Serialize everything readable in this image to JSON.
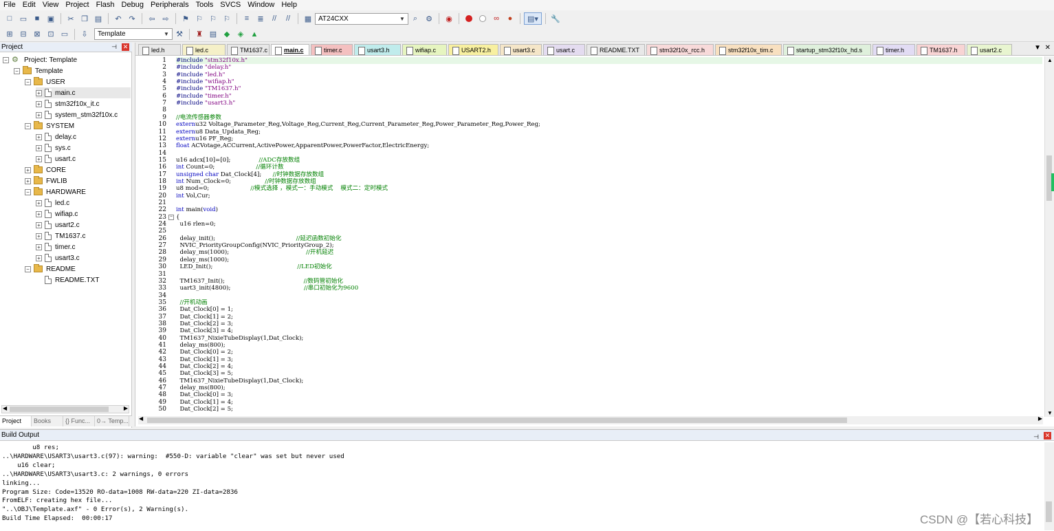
{
  "menu": [
    "File",
    "Edit",
    "View",
    "Project",
    "Flash",
    "Debug",
    "Peripherals",
    "Tools",
    "SVCS",
    "Window",
    "Help"
  ],
  "toolbar": {
    "target_combo": "AT24CXX",
    "target_select": "Template"
  },
  "project_panel": {
    "title": "Project",
    "tree": [
      {
        "label": "Project: Template",
        "kind": "project",
        "level": 0
      },
      {
        "label": "Template",
        "kind": "group",
        "level": 1
      },
      {
        "label": "USER",
        "kind": "folder",
        "level": 2
      },
      {
        "label": "main.c",
        "kind": "file",
        "level": 3,
        "selected": true
      },
      {
        "label": "stm32f10x_it.c",
        "kind": "file",
        "level": 3
      },
      {
        "label": "system_stm32f10x.c",
        "kind": "file",
        "level": 3
      },
      {
        "label": "SYSTEM",
        "kind": "folder",
        "level": 2
      },
      {
        "label": "delay.c",
        "kind": "file",
        "level": 3
      },
      {
        "label": "sys.c",
        "kind": "file",
        "level": 3
      },
      {
        "label": "usart.c",
        "kind": "file",
        "level": 3
      },
      {
        "label": "CORE",
        "kind": "folder-collapsed",
        "level": 2
      },
      {
        "label": "FWLIB",
        "kind": "folder-collapsed",
        "level": 2
      },
      {
        "label": "HARDWARE",
        "kind": "folder",
        "level": 2
      },
      {
        "label": "led.c",
        "kind": "file",
        "level": 3
      },
      {
        "label": "wifiap.c",
        "kind": "file",
        "level": 3
      },
      {
        "label": "usart2.c",
        "kind": "file",
        "level": 3
      },
      {
        "label": "TM1637.c",
        "kind": "file",
        "level": 3
      },
      {
        "label": "timer.c",
        "kind": "file",
        "level": 3
      },
      {
        "label": "usart3.c",
        "kind": "file",
        "level": 3
      },
      {
        "label": "README",
        "kind": "folder",
        "level": 2
      },
      {
        "label": "README.TXT",
        "kind": "file-plain",
        "level": 3
      }
    ],
    "bottom_tabs": [
      "Project",
      "Books",
      "{} Func...",
      "0→ Temp..."
    ]
  },
  "editor_tabs": [
    {
      "label": "led.h",
      "color": "#e8e8e8"
    },
    {
      "label": "led.c",
      "color": "#f5f0c8"
    },
    {
      "label": "TM1637.c",
      "color": "#e8e8e8"
    },
    {
      "label": "main.c",
      "color": "#ffffff",
      "active": true
    },
    {
      "label": "timer.c",
      "color": "#f4c0c0"
    },
    {
      "label": "usart3.h",
      "color": "#c0ecec"
    },
    {
      "label": "wifiap.c",
      "color": "#e6f5c0"
    },
    {
      "label": "USART2.h",
      "color": "#f8f0a0"
    },
    {
      "label": "usart3.c",
      "color": "#f5e6c8"
    },
    {
      "label": "usart.c",
      "color": "#e4dcf0"
    },
    {
      "label": "README.TXT",
      "color": "#e8e8e8"
    },
    {
      "label": "stm32f10x_rcc.h",
      "color": "#f8dada"
    },
    {
      "label": "stm32f10x_tim.c",
      "color": "#f8e0c0"
    },
    {
      "label": "startup_stm32f10x_hd.s",
      "color": "#dff0dc"
    },
    {
      "label": "timer.h",
      "color": "#e2dcf4"
    },
    {
      "label": "TM1637.h",
      "color": "#f8d4d4"
    },
    {
      "label": "usart2.c",
      "color": "#e8f5d0"
    }
  ],
  "code_lines": [
    "1",
    "2",
    "3",
    "4",
    "5",
    "6",
    "7",
    "8",
    "9",
    "10",
    "11",
    "12",
    "13",
    "14",
    "15",
    "16",
    "17",
    "18",
    "19",
    "20",
    "21",
    "22",
    "23",
    "24",
    "25",
    "26",
    "27",
    "28",
    "29",
    "30",
    "31",
    "32",
    "33",
    "34",
    "35",
    "36",
    "37",
    "38",
    "39",
    "40",
    "41",
    "42",
    "43",
    "44",
    "45",
    "46",
    "47",
    "48",
    "49",
    "50"
  ],
  "code": [
    {
      "t": [
        [
          "pp",
          "#include "
        ],
        [
          "str",
          "\"stm32f10x.h\""
        ]
      ]
    },
    {
      "t": [
        [
          "pp",
          "#include "
        ],
        [
          "str",
          "\"delay.h\""
        ]
      ]
    },
    {
      "t": [
        [
          "pp",
          "#include "
        ],
        [
          "str",
          "\"led.h\""
        ]
      ]
    },
    {
      "t": [
        [
          "pp",
          "#include "
        ],
        [
          "str",
          "\"wifiap.h\""
        ]
      ]
    },
    {
      "t": [
        [
          "pp",
          "#include "
        ],
        [
          "str",
          "\"TM1637.h\""
        ]
      ]
    },
    {
      "t": [
        [
          "pp",
          "#include "
        ],
        [
          "str",
          "\"timer.h\""
        ]
      ]
    },
    {
      "t": [
        [
          "pp",
          "#include "
        ],
        [
          "str",
          "\"usart3.h\""
        ]
      ]
    },
    {
      "t": []
    },
    {
      "t": [
        [
          "cm",
          "//电流传感器参数"
        ]
      ]
    },
    {
      "t": [
        [
          "kw",
          "extern"
        ],
        [
          "",
          "u32 Voltage_Parameter_Reg,Voltage_Reg,Current_Reg,Current_Parameter_Reg,Power_Parameter_Reg,Power_Reg;"
        ]
      ]
    },
    {
      "t": [
        [
          "kw",
          "extern"
        ],
        [
          "",
          "u8 Data_Updata_Reg;"
        ]
      ]
    },
    {
      "t": [
        [
          "kw",
          "extern"
        ],
        [
          "",
          "u16 PF_Reg;"
        ]
      ]
    },
    {
      "t": [
        [
          "kw",
          "float"
        ],
        [
          "",
          " ACVotage,ACCurrent,ActivePower,ApparentPower,PowerFactor,ElectricEnergy;"
        ]
      ]
    },
    {
      "t": []
    },
    {
      "t": [
        [
          "",
          "u16 adcx[10]=[0];               "
        ],
        [
          "cm",
          "//ADC存放数组"
        ]
      ]
    },
    {
      "t": [
        [
          "kw",
          "int"
        ],
        [
          "",
          " Count=0;                      "
        ],
        [
          "cm",
          "//循环计数"
        ]
      ]
    },
    {
      "t": [
        [
          "kw",
          "unsigned char"
        ],
        [
          "",
          " Dat_Clock[4];      "
        ],
        [
          "cm",
          "//时钟数据存放数组"
        ]
      ]
    },
    {
      "t": [
        [
          "kw",
          "int"
        ],
        [
          "",
          " Num_Clock=0;                  "
        ],
        [
          "cm",
          "//时钟数据存放数组"
        ]
      ]
    },
    {
      "t": [
        [
          "",
          "u8 mod=0;                      "
        ],
        [
          "cm",
          "//模式选择 ，模式一：手动模式    模式二：定时模式"
        ]
      ]
    },
    {
      "t": [
        [
          "kw",
          "int"
        ],
        [
          "",
          " Vol,Cur;"
        ]
      ]
    },
    {
      "t": []
    },
    {
      "t": [
        [
          "kw",
          "int"
        ],
        [
          "",
          " main("
        ],
        [
          "kw",
          "void"
        ],
        [
          "",
          ")"
        ]
      ]
    },
    {
      "t": [
        [
          "",
          "{"
        ]
      ]
    },
    {
      "t": [
        [
          "",
          "  u16 rlen=0;"
        ]
      ]
    },
    {
      "t": []
    },
    {
      "t": [
        [
          "",
          "  delay_init();                                           "
        ],
        [
          "cm",
          "//延迟函数初始化"
        ]
      ]
    },
    {
      "t": [
        [
          "",
          "  NVIC_PriorityGroupConfig(NVIC_PriorityGroup_2);"
        ]
      ]
    },
    {
      "t": [
        [
          "",
          "  delay_ms(1000);                                         "
        ],
        [
          "cm",
          "//开机延迟"
        ]
      ]
    },
    {
      "t": [
        [
          "",
          "  delay_ms(1000);"
        ]
      ]
    },
    {
      "t": [
        [
          "",
          "  LED_Init();                                             "
        ],
        [
          "cm",
          "//LED初始化"
        ]
      ]
    },
    {
      "t": []
    },
    {
      "t": [
        [
          "",
          "  TM1637_Init();                                          "
        ],
        [
          "cm",
          "//数码管初始化"
        ]
      ]
    },
    {
      "t": [
        [
          "",
          "  uart3_init(4800);                                       "
        ],
        [
          "cm",
          "//串口初始化为9600"
        ]
      ]
    },
    {
      "t": []
    },
    {
      "t": [
        [
          "cm",
          "  //开机动画"
        ]
      ]
    },
    {
      "t": [
        [
          "",
          "  Dat_Clock[0] = 1;"
        ]
      ]
    },
    {
      "t": [
        [
          "",
          "  Dat_Clock[1] = 2;"
        ]
      ]
    },
    {
      "t": [
        [
          "",
          "  Dat_Clock[2] = 3;"
        ]
      ]
    },
    {
      "t": [
        [
          "",
          "  Dat_Clock[3] = 4;"
        ]
      ]
    },
    {
      "t": [
        [
          "",
          "  TM1637_NixieTubeDisplay(1,Dat_Clock);"
        ]
      ]
    },
    {
      "t": [
        [
          "",
          "  delay_ms(800);"
        ]
      ]
    },
    {
      "t": [
        [
          "",
          "  Dat_Clock[0] = 2;"
        ]
      ]
    },
    {
      "t": [
        [
          "",
          "  Dat_Clock[1] = 3;"
        ]
      ]
    },
    {
      "t": [
        [
          "",
          "  Dat_Clock[2] = 4;"
        ]
      ]
    },
    {
      "t": [
        [
          "",
          "  Dat_Clock[3] = 5;"
        ]
      ]
    },
    {
      "t": [
        [
          "",
          "  TM1637_NixieTubeDisplay(1,Dat_Clock);"
        ]
      ]
    },
    {
      "t": [
        [
          "",
          "  delay_ms(800);"
        ]
      ]
    },
    {
      "t": [
        [
          "",
          "  Dat_Clock[0] = 3;"
        ]
      ]
    },
    {
      "t": [
        [
          "",
          "  Dat_Clock[1] = 4;"
        ]
      ]
    },
    {
      "t": [
        [
          "",
          "  Dat_Clock[2] = 5;"
        ]
      ]
    }
  ],
  "build_output": {
    "title": "Build Output",
    "lines": [
      "        u8 res;",
      "..\\HARDWARE\\USART3\\usart3.c(97): warning:  #550-D: variable \"clear\" was set but never used",
      "    u16 clear;",
      "..\\HARDWARE\\USART3\\usart3.c: 2 warnings, 0 errors",
      "linking...",
      "Program Size: Code=13520 RO-data=1008 RW-data=220 ZI-data=2836",
      "FromELF: creating hex file...",
      "\"..\\OBJ\\Template.axf\" - 0 Error(s), 2 Warning(s).",
      "Build Time Elapsed:  00:00:17"
    ]
  },
  "watermark": "CSDN @【若心科技】"
}
